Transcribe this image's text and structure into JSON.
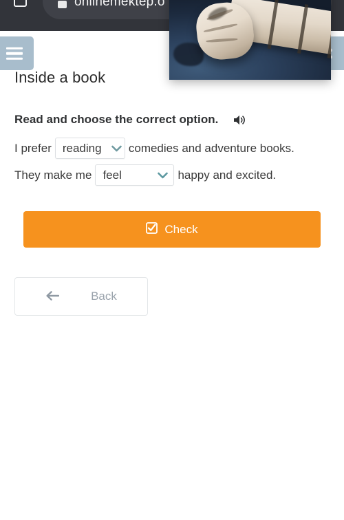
{
  "browser": {
    "url_text": "onlinemektep.o",
    "tabs_icon": "tab-switcher-icon",
    "site_icon": "site-page-icon"
  },
  "nav": {
    "menu_icon": "hamburger-menu-icon",
    "more_icon": "more-options-icon"
  },
  "header": {
    "title": "Inside a book"
  },
  "instruction": {
    "text": "Read and choose the correct option.",
    "audio_icon": "speaker-icon"
  },
  "exercise": {
    "sentences": [
      {
        "before": "I prefer",
        "dropdown": {
          "value": "reading",
          "icon": "chevron-down-icon"
        },
        "after": "comedies and adventure books."
      },
      {
        "before": "They make me",
        "dropdown": {
          "value": "feel",
          "icon": "chevron-down-icon"
        },
        "after": "happy and excited."
      }
    ]
  },
  "actions": {
    "check": {
      "label": "Check",
      "icon": "checked-box-icon",
      "color": "#f6921e"
    },
    "back": {
      "label": "Back",
      "icon": "arrow-left-icon"
    }
  },
  "overlay": {
    "name": "video-thumbnail-overlay"
  }
}
